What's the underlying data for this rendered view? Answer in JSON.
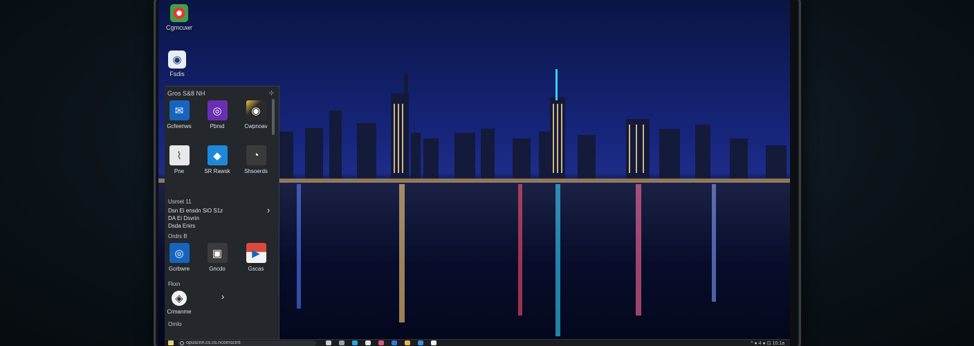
{
  "desktop": {
    "icons": [
      {
        "label": "Cgmcuwr",
        "icon": "chrome-icon"
      },
      {
        "label": "Fsdis",
        "icon": "folder-icon"
      }
    ]
  },
  "start_menu": {
    "header": "Gros S&8 NH",
    "pin_glyph": "⊹",
    "pinned": [
      {
        "label": "Gcfeenws",
        "icon": "mail-icon",
        "color": "#1565c0"
      },
      {
        "label": "Pbrsd",
        "icon": "purple-app-icon",
        "color": "#6a2fb0"
      },
      {
        "label": "Cwpnoav",
        "icon": "camera-icon",
        "color": "#2b2b2b"
      },
      {
        "label": "Pne",
        "icon": "chart-icon",
        "color": "#e8e8e8"
      },
      {
        "label": "SR Rawsk",
        "icon": "edge-icon",
        "color": "#1e88d8"
      },
      {
        "label": "Shsoerds",
        "icon": "settings-icon",
        "color": "#3a3a3a"
      }
    ],
    "section1": {
      "title": "Usmet 11",
      "lines": [
        "Dsn Ei ensdn SiO S1z",
        "DA Ei Dsvrin",
        "Dsda Enirs"
      ]
    },
    "section2": {
      "title": "Ordrs B",
      "apps": [
        {
          "label": "Gcrbwre",
          "icon": "target-icon",
          "color": "#1565c0"
        },
        {
          "label": "Gncdo",
          "icon": "store-icon",
          "color": "#3b3b3b"
        },
        {
          "label": "Gscas",
          "icon": "play-icon",
          "color": "#d94a3a"
        }
      ]
    },
    "section3": {
      "title": "Fkxn",
      "app": {
        "label": "Crmanme",
        "icon": "shield-icon"
      }
    },
    "footer": "Ornlo"
  },
  "taskbar": {
    "search_text": "opuscnn.cs.cs.ncornscmt",
    "tray": "^ ● 4 ● ⊡ 10:1a"
  }
}
